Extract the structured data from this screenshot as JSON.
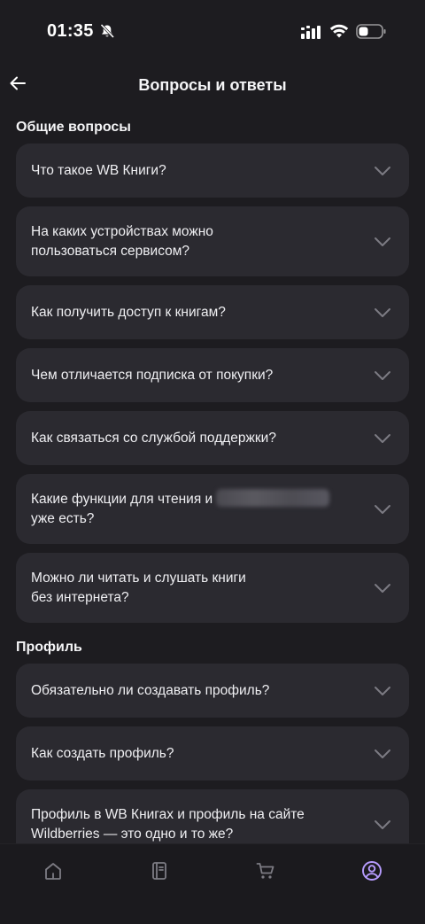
{
  "status": {
    "time": "01:35"
  },
  "header": {
    "title": "Вопросы и ответы"
  },
  "sections": [
    {
      "title": "Общие вопросы",
      "items": [
        {
          "q": "Что такое WB Книги?"
        },
        {
          "q": "На каких устройствах можно\nпользоваться сервисом?"
        },
        {
          "q": "Как получить доступ к книгам?"
        },
        {
          "q": "Чем отличается подписка от покупки?"
        },
        {
          "q": "Как связаться со службой поддержки?"
        },
        {
          "q1": "Какие функции для чтения и",
          "q2": "уже есть?"
        },
        {
          "q": "Можно ли читать и слушать книги\nбез интернета?"
        }
      ]
    },
    {
      "title": "Профиль",
      "items": [
        {
          "q": "Обязательно ли создавать профиль?"
        },
        {
          "q": "Как создать профиль?"
        },
        {
          "q": "Профиль в WB Книгах и профиль на сайте\nWildberries — это одно и то же?"
        }
      ]
    }
  ],
  "tabbar": {
    "icons": [
      "home-icon",
      "book-icon",
      "cart-icon",
      "profile-icon"
    ],
    "active_color": "#b79cff",
    "inactive_color": "#7d7c84"
  }
}
